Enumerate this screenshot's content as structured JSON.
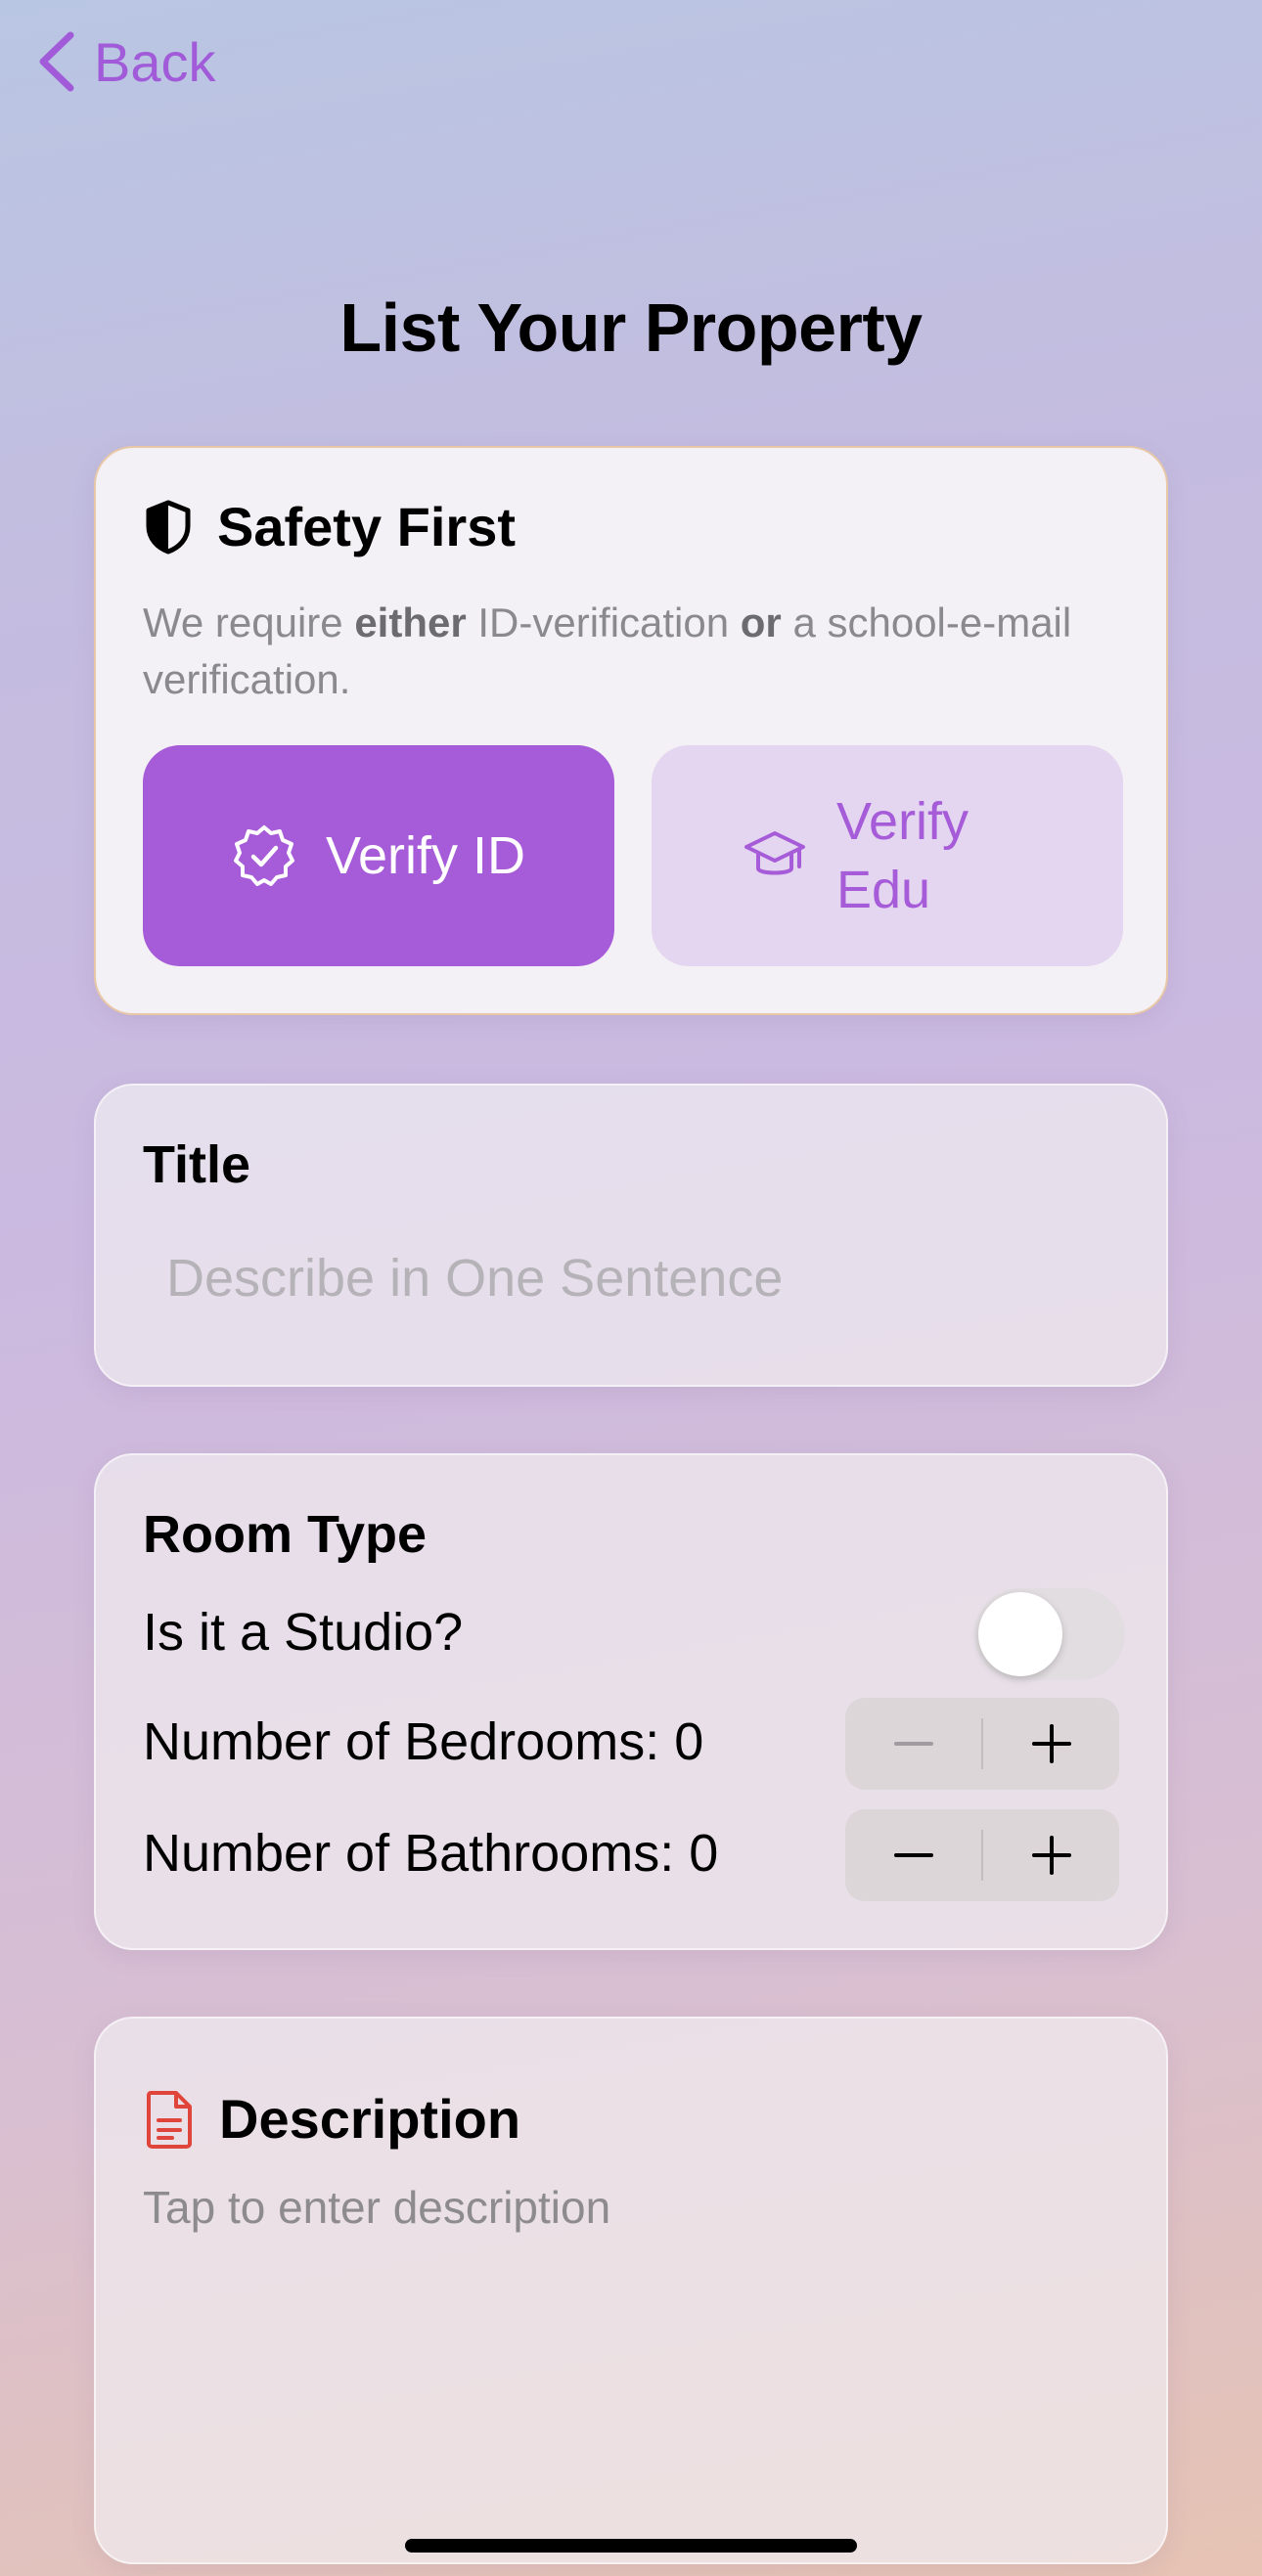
{
  "nav": {
    "back_label": "Back"
  },
  "page": {
    "title": "List Your Property"
  },
  "safety": {
    "heading": "Safety First",
    "text_1": "We require ",
    "text_either": "either",
    "text_2": " ID-verification ",
    "text_or": "or",
    "text_3": " a school-e-mail verification.",
    "verify_id_label": "Verify ID",
    "verify_edu_label": "Verify Edu",
    "accent_color": "#a65bd8"
  },
  "title_field": {
    "label": "Title",
    "placeholder": "Describe in One Sentence",
    "value": ""
  },
  "room": {
    "heading": "Room Type",
    "studio_label": "Is it a Studio?",
    "studio_on": false,
    "bedrooms_label": "Number of Bedrooms: 0",
    "bathrooms_label": "Number of Bathrooms: 0"
  },
  "description": {
    "heading": "Description",
    "placeholder": "Tap to enter description",
    "icon_color": "#e0453b"
  }
}
